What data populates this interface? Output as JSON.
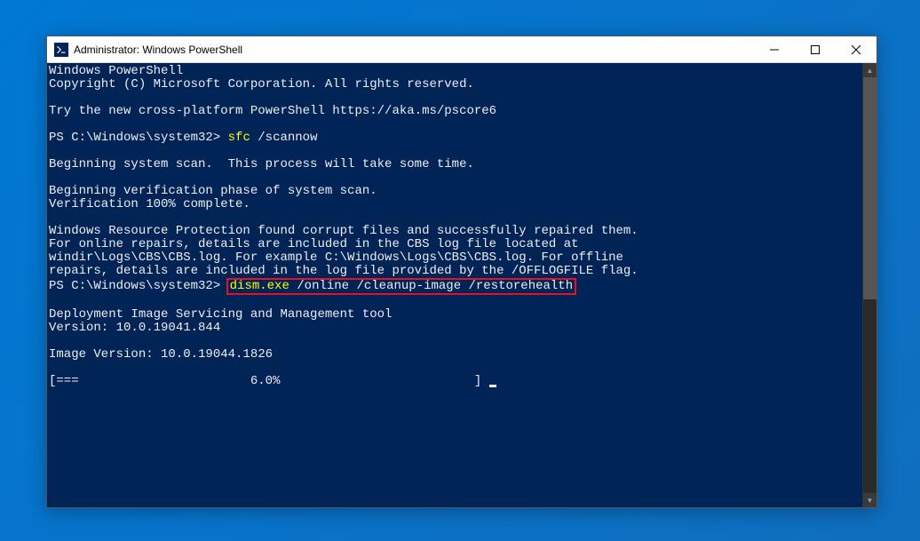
{
  "window": {
    "title": "Administrator: Windows PowerShell"
  },
  "terminal": {
    "lines": {
      "l0": "Windows PowerShell",
      "l1": "Copyright (C) Microsoft Corporation. All rights reserved.",
      "l2": "",
      "l3": "Try the new cross-platform PowerShell https://aka.ms/pscore6",
      "l4": "",
      "prompt1": "PS C:\\Windows\\system32> ",
      "cmd1": "sfc",
      "cmd1args": " /scannow",
      "l6": "",
      "l7": "Beginning system scan.  This process will take some time.",
      "l8": "",
      "l9": "Beginning verification phase of system scan.",
      "l10": "Verification 100% complete.",
      "l11": "",
      "l12": "Windows Resource Protection found corrupt files and successfully repaired them.",
      "l13": "For online repairs, details are included in the CBS log file located at",
      "l14": "windir\\Logs\\CBS\\CBS.log. For example C:\\Windows\\Logs\\CBS\\CBS.log. For offline",
      "l15": "repairs, details are included in the log file provided by the /OFFLOGFILE flag.",
      "prompt2": "PS C:\\Windows\\system32> ",
      "cmd2": "dism.exe",
      "cmd2args": " /online /cleanup-image /restorehealth",
      "l17": "",
      "l18": "Deployment Image Servicing and Management tool",
      "l19": "Version: 10.0.19041.844",
      "l20": "",
      "l21": "Image Version: 10.0.19044.1826",
      "l22": "",
      "progress": "[===                       6.0%                          ] "
    }
  }
}
